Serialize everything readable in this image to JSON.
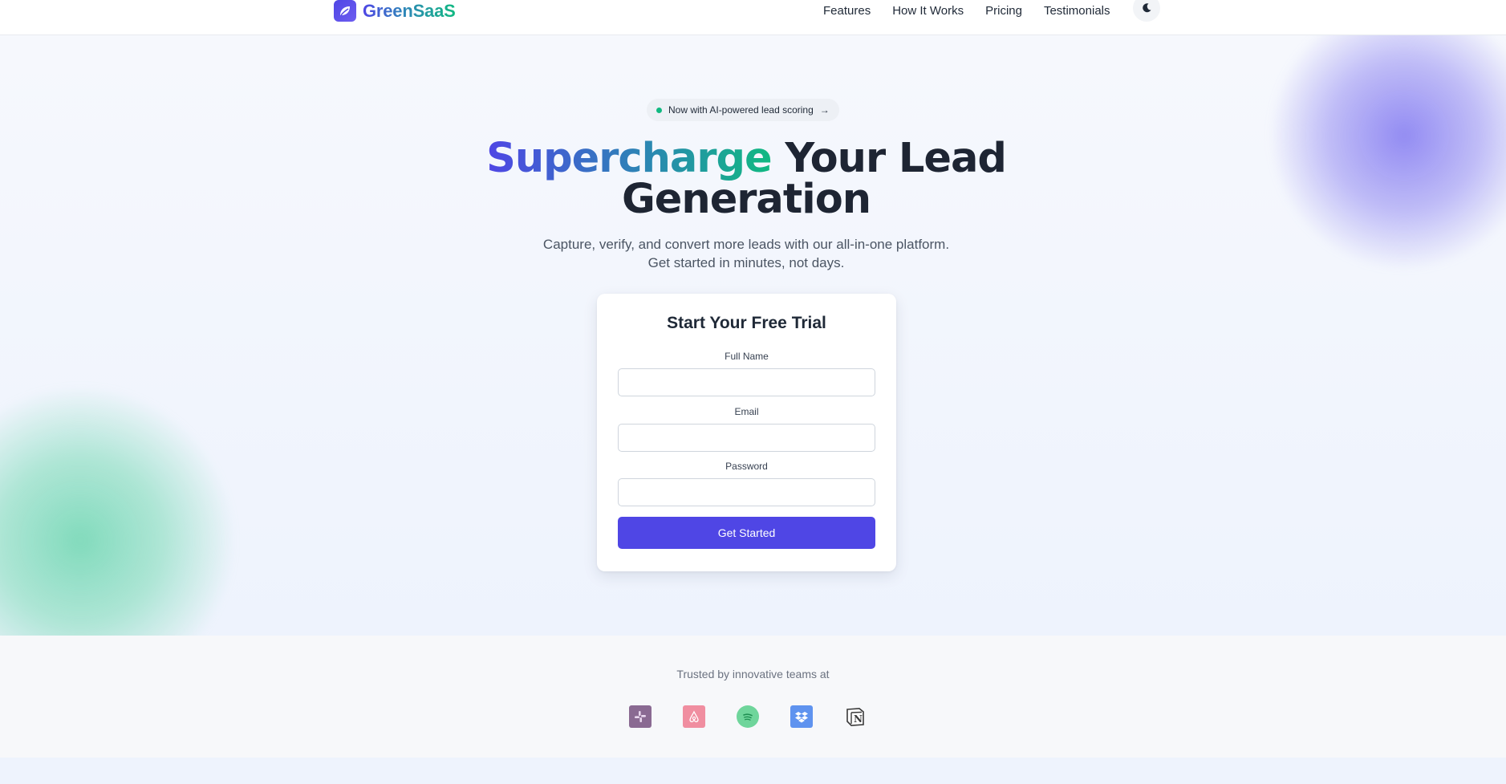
{
  "header": {
    "brand": "GreenSaaS",
    "nav": [
      "Features",
      "How It Works",
      "Pricing",
      "Testimonials"
    ],
    "theme_toggle_icon": "moon-icon"
  },
  "hero": {
    "badge": "Now with AI-powered lead scoring",
    "badge_dot_color": "#10b981",
    "title_highlight": "Supercharge",
    "title_rest_line1": " Your Lead",
    "title_line2": "Generation",
    "subtitle_line1": "Capture, verify, and convert more leads with our all-in-one platform.",
    "subtitle_line2": "Get started in minutes, not days."
  },
  "form": {
    "title": "Start Your Free Trial",
    "full_name_label": "Full Name",
    "full_name_value": "",
    "email_label": "Email",
    "email_value": "",
    "password_label": "Password",
    "password_value": "",
    "submit_label": "Get Started"
  },
  "trusted": {
    "label": "Trusted by innovative teams at",
    "logos": [
      "slack-logo",
      "airbnb-logo",
      "spotify-logo",
      "dropbox-logo",
      "notion-logo"
    ]
  },
  "colors": {
    "accent": "#4f46e5",
    "accent_green": "#10b981"
  }
}
